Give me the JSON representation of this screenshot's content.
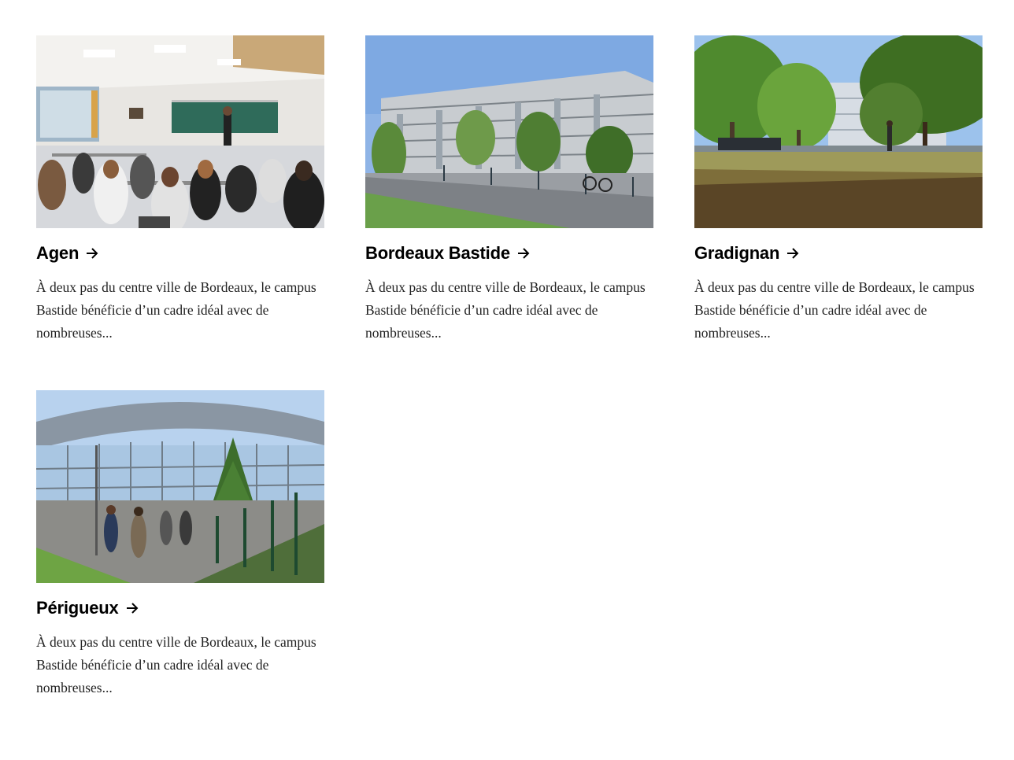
{
  "campuses": [
    {
      "name": "Agen",
      "description": "À deux pas du centre ville de Bordeaux, le campus Bastide bénéficie d’un cadre idéal avec de nombreuses...",
      "image_alt": "classroom"
    },
    {
      "name": "Bordeaux Bastide",
      "description": "À deux pas du centre ville de Bordeaux, le campus Bastide bénéficie d’un cadre idéal avec de nombreuses...",
      "image_alt": "building"
    },
    {
      "name": "Gradignan",
      "description": "À deux pas du centre ville de Bordeaux, le campus Bastide bénéficie d’un cadre idéal avec de nombreuses...",
      "image_alt": "park"
    },
    {
      "name": "Périgueux",
      "description": "À deux pas du centre ville de Bordeaux, le campus Bastide bénéficie d’un cadre idéal avec de nombreuses...",
      "image_alt": "glass-building"
    }
  ],
  "icons": {
    "link_arrow": "arrow-right-icon"
  }
}
